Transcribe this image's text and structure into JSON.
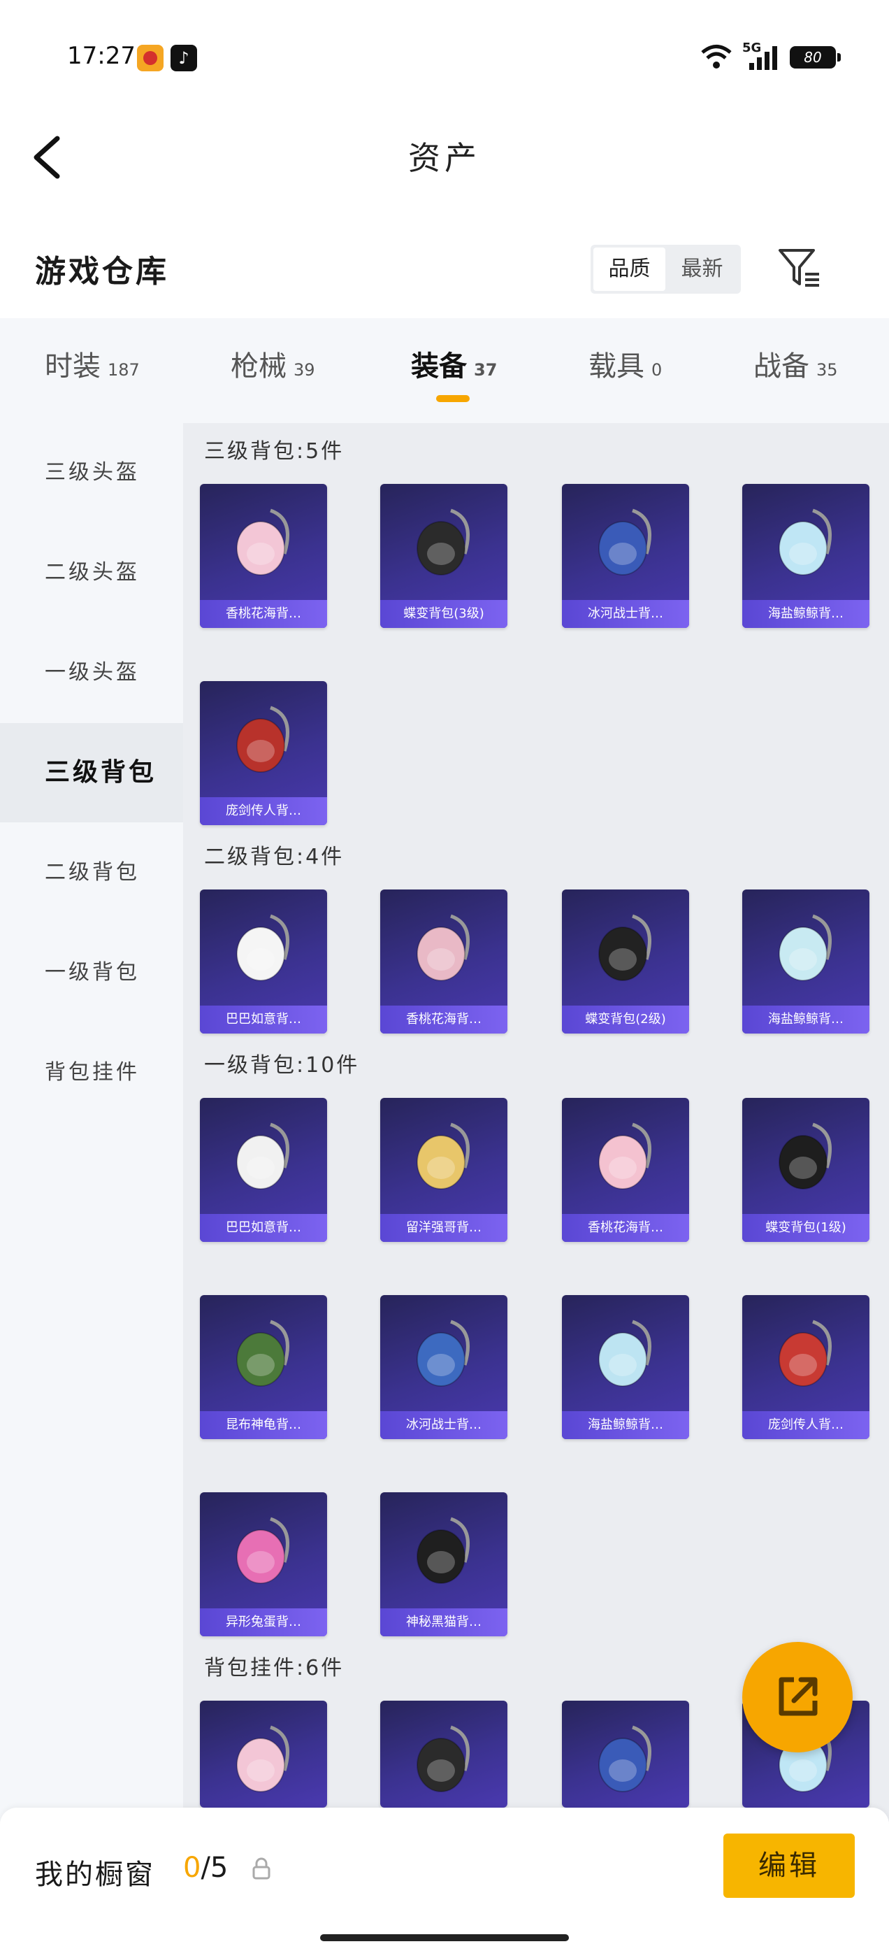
{
  "status": {
    "time": "17:27",
    "network": "5G",
    "battery": "80"
  },
  "header": {
    "title": "资产"
  },
  "warehouse": {
    "title": "游戏仓库",
    "sort_quality": "品质",
    "sort_newest": "最新"
  },
  "tabs": [
    {
      "label": "时装",
      "count": "187"
    },
    {
      "label": "枪械",
      "count": "39"
    },
    {
      "label": "装备",
      "count": "37"
    },
    {
      "label": "载具",
      "count": "0"
    },
    {
      "label": "战备",
      "count": "35"
    }
  ],
  "sidebar": [
    {
      "label": "三级头盔"
    },
    {
      "label": "二级头盔"
    },
    {
      "label": "一级头盔"
    },
    {
      "label": "三级背包"
    },
    {
      "label": "二级背包"
    },
    {
      "label": "一级背包"
    },
    {
      "label": "背包挂件"
    }
  ],
  "sections": [
    {
      "title": "三级背包:5件",
      "items": [
        "香桃花海背…",
        "蝶变背包(3级)",
        "冰河战士背…",
        "海盐鲸鲸背…",
        "庞剑传人背…"
      ]
    },
    {
      "title": "二级背包:4件",
      "items": [
        "巴巴如意背…",
        "香桃花海背…",
        "蝶变背包(2级)",
        "海盐鲸鲸背…"
      ]
    },
    {
      "title": "一级背包:10件",
      "items": [
        "巴巴如意背…",
        "留洋强哥背…",
        "香桃花海背…",
        "蝶变背包(1级)",
        "昆布神龟背…",
        "冰河战士背…",
        "海盐鲸鲸背…",
        "庞剑传人背…",
        "异形兔蛋背…",
        "神秘黑猫背…"
      ]
    },
    {
      "title": "背包挂件:6件",
      "items": [
        "",
        "",
        "",
        ""
      ]
    }
  ],
  "bottom": {
    "showcase_label": "我的橱窗",
    "count_current": "0",
    "count_total": "/5",
    "edit_label": "编辑"
  },
  "colors": {
    "accent": "#f7a600",
    "card_bg": "#3b3290",
    "card_label": "#6a55e6"
  }
}
